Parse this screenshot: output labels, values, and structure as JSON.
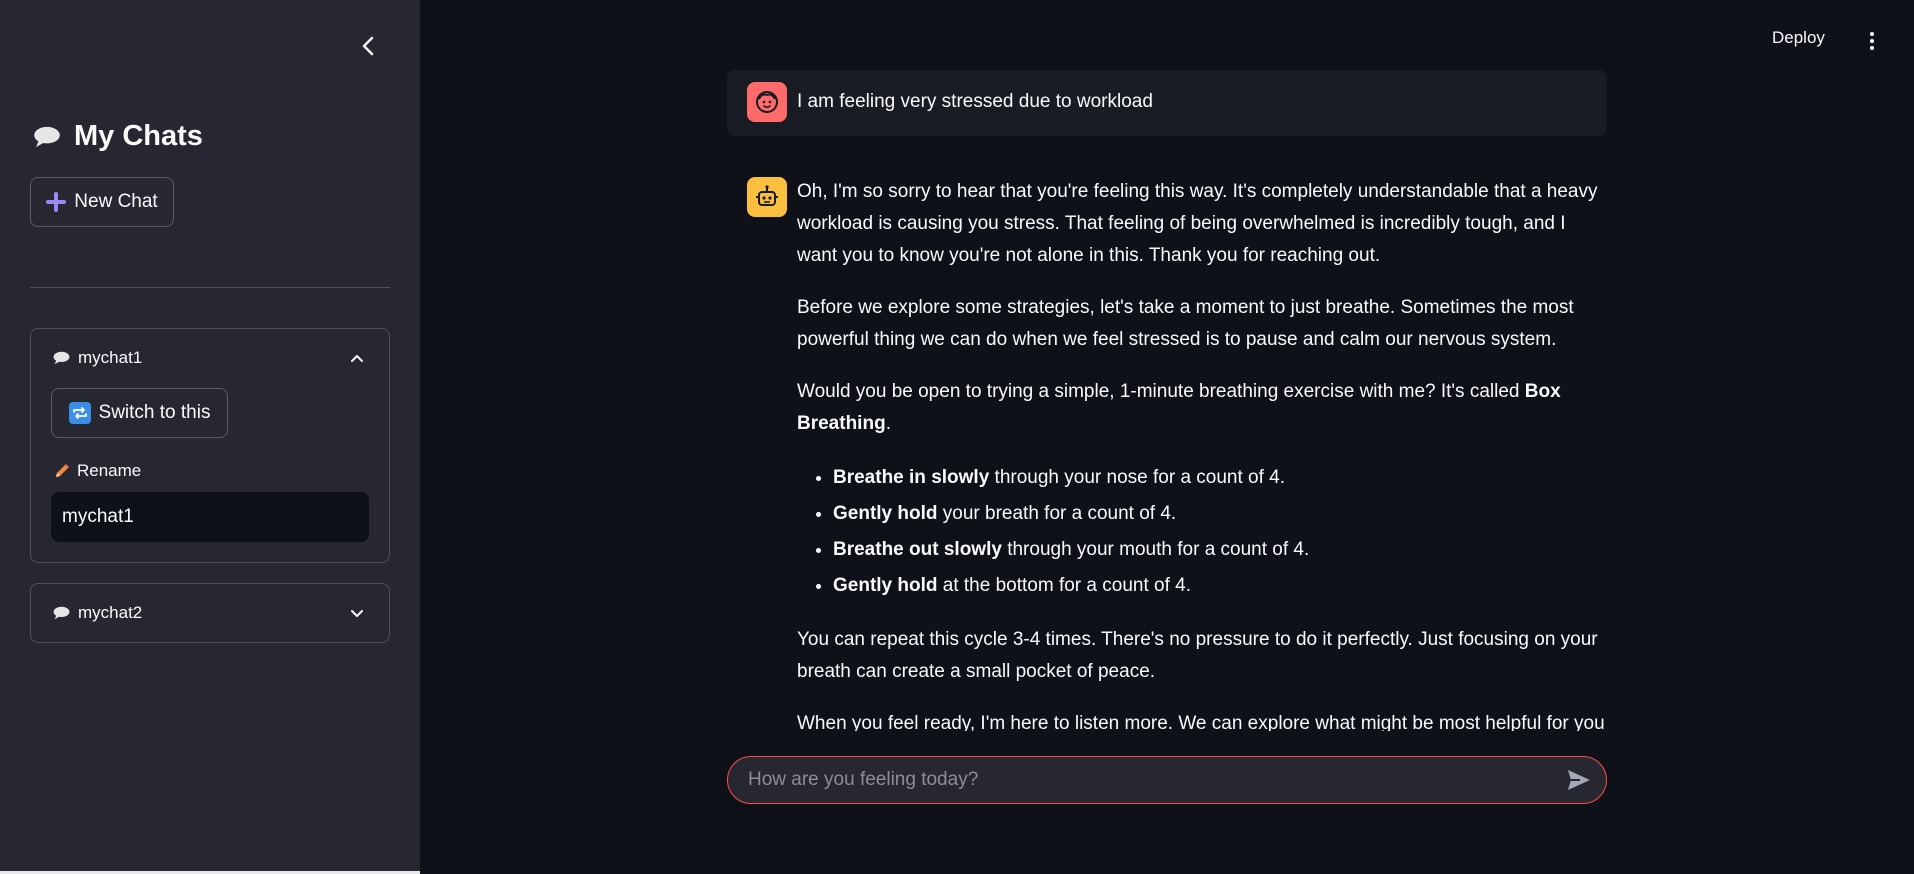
{
  "sidebar": {
    "title": "My Chats",
    "title_icon": "speech-balloon-icon",
    "new_chat_label": "New Chat",
    "collapse_icon": "chevron-left-icon",
    "chats": [
      {
        "name": "mychat1",
        "expanded": true,
        "switch_label": "Switch to this",
        "rename_label": "Rename",
        "rename_value": "mychat1"
      },
      {
        "name": "mychat2",
        "expanded": false
      }
    ]
  },
  "header": {
    "deploy_label": "Deploy",
    "menu_icon": "more-vertical-icon"
  },
  "messages": {
    "user": {
      "avatar_icon": "user-face-icon",
      "text": "I am feeling very stressed due to workload"
    },
    "assistant": {
      "avatar_icon": "robot-icon",
      "p1": "Oh, I'm so sorry to hear that you're feeling this way. It's completely understandable that a heavy workload is causing you stress. That feeling of being overwhelmed is incredibly tough, and I want you to know you're not alone in this. Thank you for reaching out.",
      "p2": "Before we explore some strategies, let's take a moment to just breathe. Sometimes the most powerful thing we can do when we feel stressed is to pause and calm our nervous system.",
      "p3_prefix": "Would you be open to trying a simple, 1-minute breathing exercise with me? It's called ",
      "p3_bold": "Box Breathing",
      "p3_suffix": ".",
      "list": [
        {
          "bold": "Breathe in slowly",
          "rest": " through your nose for a count of 4."
        },
        {
          "bold": "Gently hold",
          "rest": " your breath for a count of 4."
        },
        {
          "bold": "Breathe out slowly",
          "rest": " through your mouth for a count of 4."
        },
        {
          "bold": "Gently hold",
          "rest": " at the bottom for a count of 4."
        }
      ],
      "p4": "You can repeat this cycle 3-4 times. There's no pressure to do it perfectly. Just focusing on your breath can create a small pocket of peace.",
      "p5": "When you feel ready, I'm here to listen more. We can explore what might be most helpful for you"
    }
  },
  "chat_input": {
    "placeholder": "How are you feeling today?",
    "value": "",
    "send_icon": "send-icon"
  },
  "colors": {
    "background": "#0e1117",
    "sidebar": "#262730",
    "accent": "#ff4b4b",
    "user_avatar": "#ff6b6b",
    "bot_avatar": "#fbbf3f"
  }
}
